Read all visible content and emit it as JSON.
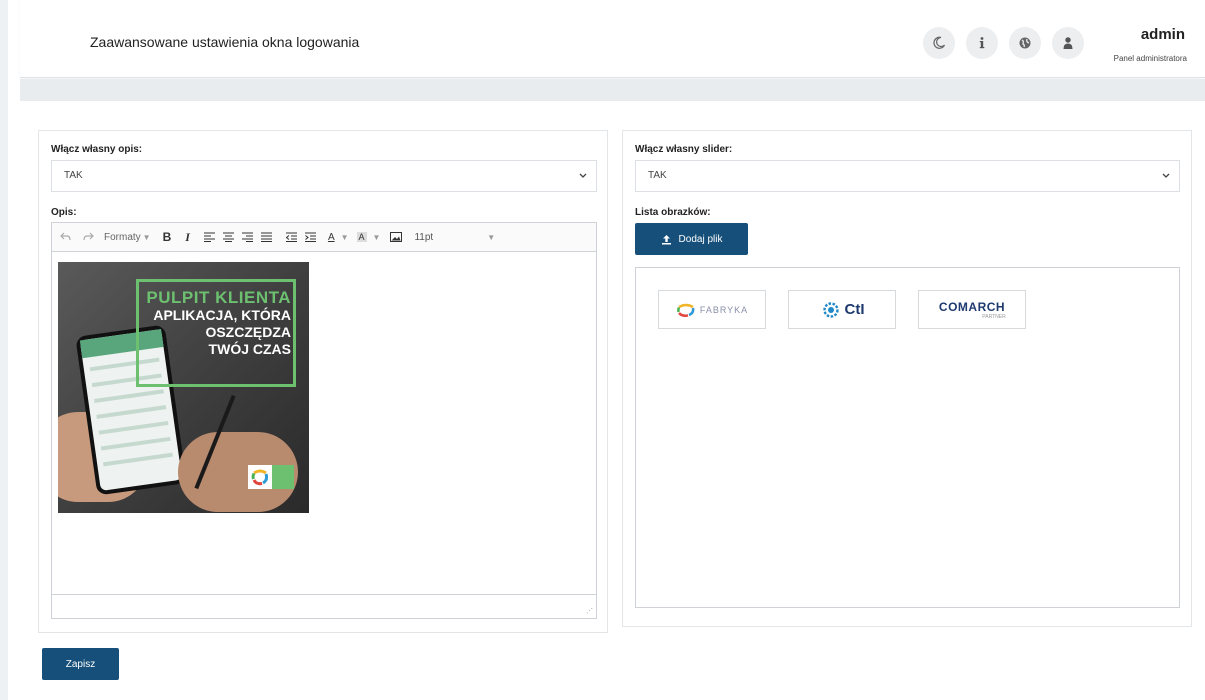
{
  "header": {
    "title": "Zaawansowane ustawienia okna logowania",
    "icons": [
      "moon-icon",
      "info-icon",
      "globe-icon",
      "user-icon"
    ],
    "user": {
      "name": "admin",
      "role": "Panel administratora"
    }
  },
  "left_panel": {
    "custom_description_label": "Włącz własny opis:",
    "custom_description_value": "TAK",
    "description_label": "Opis:",
    "toolbar": {
      "formats_label": "Formaty",
      "bold_label": "B",
      "italic_label": "I",
      "text_color_label": "A",
      "bg_color_label": "A",
      "font_size": "11pt"
    },
    "image": {
      "heading": "PULPIT KLIENTA",
      "line1": "APLIKACJA, KTÓRA",
      "line2": "OSZCZĘDZA",
      "line3": "TWÓJ CZAS",
      "accent_color": "#6cc070"
    }
  },
  "right_panel": {
    "custom_slider_label": "Włącz własny slider:",
    "custom_slider_value": "TAK",
    "image_list_label": "Lista obrazków:",
    "add_file_label": "Dodaj plik",
    "thumbnails": [
      {
        "name": "FABRYKA",
        "color": "#8a8fa8"
      },
      {
        "name": "CtI",
        "color": "#1e88c8"
      },
      {
        "name": "COMARCH",
        "sub": "PARTNER",
        "color": "#1f3a6e"
      }
    ]
  },
  "actions": {
    "save_label": "Zapisz"
  },
  "colors": {
    "primary": "#16507a",
    "background_band": "#e8ecef"
  }
}
